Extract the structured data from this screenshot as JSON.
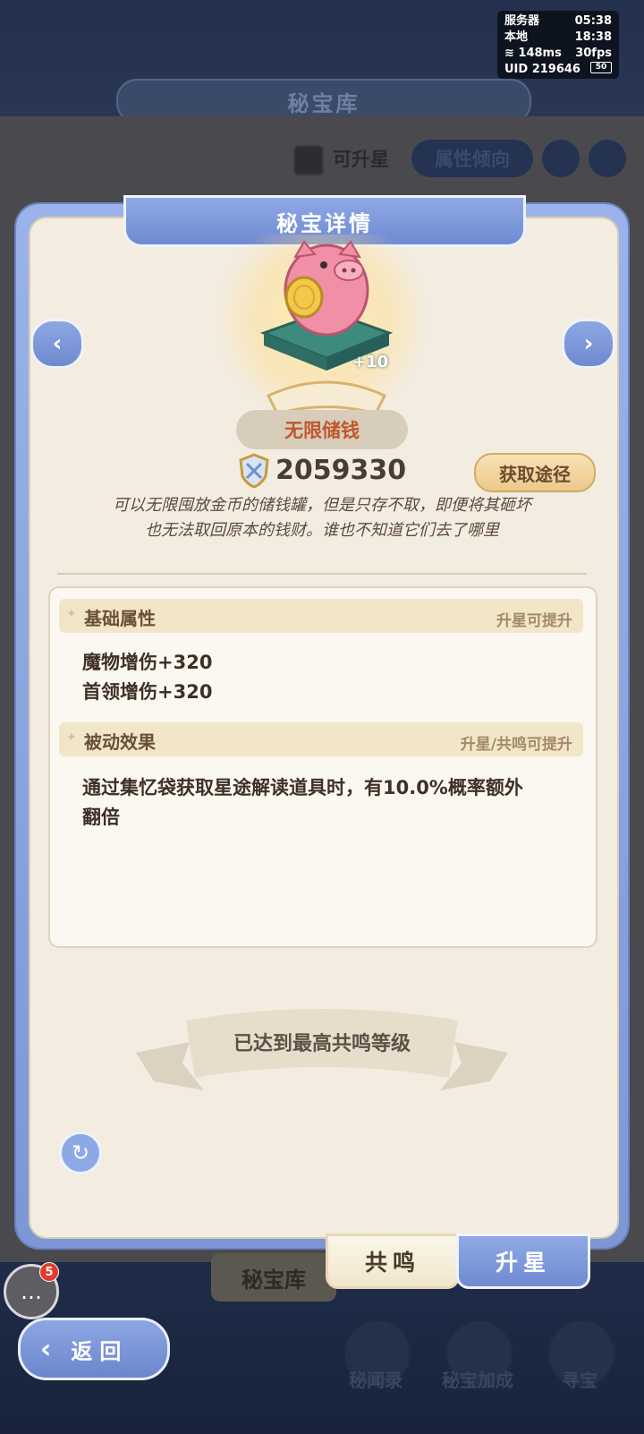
{
  "status_overlay": {
    "rows": [
      {
        "label": "服务器",
        "value": "05:38"
      },
      {
        "label": "本地",
        "value": "18:38"
      },
      {
        "label": "148ms",
        "value": "30fps"
      },
      {
        "label": "UID 219646",
        "value": "50"
      }
    ]
  },
  "background": {
    "page_title": "秘宝库",
    "filter_checkbox_label": "可升星",
    "attribute_filter": "属性倾向",
    "bottom_tab": "秘宝库",
    "nav": [
      "秘闻录",
      "秘宝加成",
      "寻宝"
    ]
  },
  "modal": {
    "title": "秘宝详情",
    "item": {
      "level_badge": "+10",
      "name": "无限储钱",
      "power": "2059330",
      "source_button": "获取途径",
      "description_line1": "可以无限囤放金币的储钱罐，但是只存不取，即便将其砸坏",
      "description_line2": "也无法取回原本的钱财。谁也不知道它们去了哪里"
    },
    "base_attributes": {
      "title": "基础属性",
      "hint": "升星可提升",
      "items": [
        "魔物增伤+320",
        "首领增伤+320"
      ]
    },
    "passive": {
      "title": "被动效果",
      "hint": "升星/共鸣可提升",
      "text_line1": "通过集忆袋获取星途解读道具时，有10.0%概率额外",
      "text_line2": "翻倍"
    },
    "max_resonance_text": "已达到最高共鸣等级",
    "tabs": {
      "resonance": "共鸣",
      "star_up": "升星"
    }
  },
  "chat": {
    "badge_count": "5"
  },
  "back_button": "返回",
  "colors": {
    "accent_blue": "#7d97d6",
    "panel_cream": "#f3ede1",
    "name_orange": "#c0582c"
  }
}
